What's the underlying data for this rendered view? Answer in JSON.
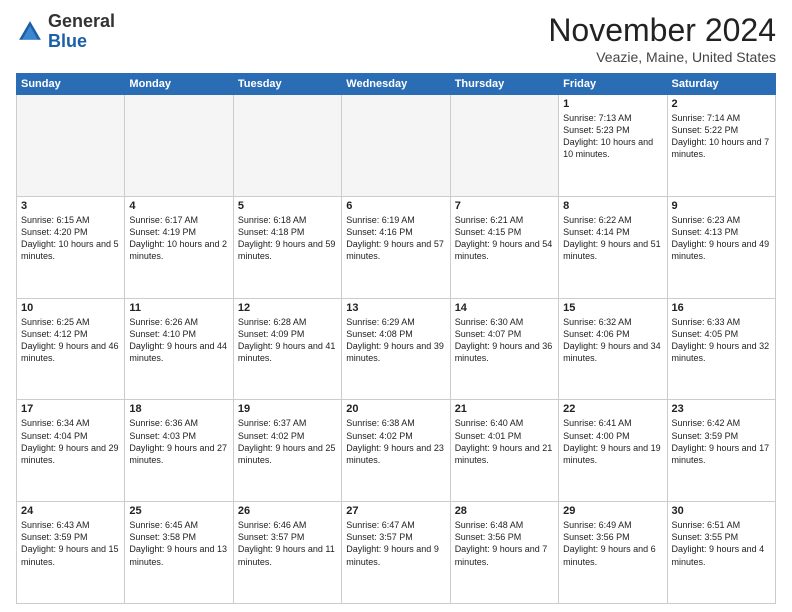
{
  "header": {
    "logo_general": "General",
    "logo_blue": "Blue",
    "month_title": "November 2024",
    "location": "Veazie, Maine, United States"
  },
  "days_of_week": [
    "Sunday",
    "Monday",
    "Tuesday",
    "Wednesday",
    "Thursday",
    "Friday",
    "Saturday"
  ],
  "weeks": [
    [
      {
        "day": "",
        "info": ""
      },
      {
        "day": "",
        "info": ""
      },
      {
        "day": "",
        "info": ""
      },
      {
        "day": "",
        "info": ""
      },
      {
        "day": "",
        "info": ""
      },
      {
        "day": "1",
        "info": "Sunrise: 7:13 AM\nSunset: 5:23 PM\nDaylight: 10 hours and 10 minutes."
      },
      {
        "day": "2",
        "info": "Sunrise: 7:14 AM\nSunset: 5:22 PM\nDaylight: 10 hours and 7 minutes."
      }
    ],
    [
      {
        "day": "3",
        "info": "Sunrise: 6:15 AM\nSunset: 4:20 PM\nDaylight: 10 hours and 5 minutes."
      },
      {
        "day": "4",
        "info": "Sunrise: 6:17 AM\nSunset: 4:19 PM\nDaylight: 10 hours and 2 minutes."
      },
      {
        "day": "5",
        "info": "Sunrise: 6:18 AM\nSunset: 4:18 PM\nDaylight: 9 hours and 59 minutes."
      },
      {
        "day": "6",
        "info": "Sunrise: 6:19 AM\nSunset: 4:16 PM\nDaylight: 9 hours and 57 minutes."
      },
      {
        "day": "7",
        "info": "Sunrise: 6:21 AM\nSunset: 4:15 PM\nDaylight: 9 hours and 54 minutes."
      },
      {
        "day": "8",
        "info": "Sunrise: 6:22 AM\nSunset: 4:14 PM\nDaylight: 9 hours and 51 minutes."
      },
      {
        "day": "9",
        "info": "Sunrise: 6:23 AM\nSunset: 4:13 PM\nDaylight: 9 hours and 49 minutes."
      }
    ],
    [
      {
        "day": "10",
        "info": "Sunrise: 6:25 AM\nSunset: 4:12 PM\nDaylight: 9 hours and 46 minutes."
      },
      {
        "day": "11",
        "info": "Sunrise: 6:26 AM\nSunset: 4:10 PM\nDaylight: 9 hours and 44 minutes."
      },
      {
        "day": "12",
        "info": "Sunrise: 6:28 AM\nSunset: 4:09 PM\nDaylight: 9 hours and 41 minutes."
      },
      {
        "day": "13",
        "info": "Sunrise: 6:29 AM\nSunset: 4:08 PM\nDaylight: 9 hours and 39 minutes."
      },
      {
        "day": "14",
        "info": "Sunrise: 6:30 AM\nSunset: 4:07 PM\nDaylight: 9 hours and 36 minutes."
      },
      {
        "day": "15",
        "info": "Sunrise: 6:32 AM\nSunset: 4:06 PM\nDaylight: 9 hours and 34 minutes."
      },
      {
        "day": "16",
        "info": "Sunrise: 6:33 AM\nSunset: 4:05 PM\nDaylight: 9 hours and 32 minutes."
      }
    ],
    [
      {
        "day": "17",
        "info": "Sunrise: 6:34 AM\nSunset: 4:04 PM\nDaylight: 9 hours and 29 minutes."
      },
      {
        "day": "18",
        "info": "Sunrise: 6:36 AM\nSunset: 4:03 PM\nDaylight: 9 hours and 27 minutes."
      },
      {
        "day": "19",
        "info": "Sunrise: 6:37 AM\nSunset: 4:02 PM\nDaylight: 9 hours and 25 minutes."
      },
      {
        "day": "20",
        "info": "Sunrise: 6:38 AM\nSunset: 4:02 PM\nDaylight: 9 hours and 23 minutes."
      },
      {
        "day": "21",
        "info": "Sunrise: 6:40 AM\nSunset: 4:01 PM\nDaylight: 9 hours and 21 minutes."
      },
      {
        "day": "22",
        "info": "Sunrise: 6:41 AM\nSunset: 4:00 PM\nDaylight: 9 hours and 19 minutes."
      },
      {
        "day": "23",
        "info": "Sunrise: 6:42 AM\nSunset: 3:59 PM\nDaylight: 9 hours and 17 minutes."
      }
    ],
    [
      {
        "day": "24",
        "info": "Sunrise: 6:43 AM\nSunset: 3:59 PM\nDaylight: 9 hours and 15 minutes."
      },
      {
        "day": "25",
        "info": "Sunrise: 6:45 AM\nSunset: 3:58 PM\nDaylight: 9 hours and 13 minutes."
      },
      {
        "day": "26",
        "info": "Sunrise: 6:46 AM\nSunset: 3:57 PM\nDaylight: 9 hours and 11 minutes."
      },
      {
        "day": "27",
        "info": "Sunrise: 6:47 AM\nSunset: 3:57 PM\nDaylight: 9 hours and 9 minutes."
      },
      {
        "day": "28",
        "info": "Sunrise: 6:48 AM\nSunset: 3:56 PM\nDaylight: 9 hours and 7 minutes."
      },
      {
        "day": "29",
        "info": "Sunrise: 6:49 AM\nSunset: 3:56 PM\nDaylight: 9 hours and 6 minutes."
      },
      {
        "day": "30",
        "info": "Sunrise: 6:51 AM\nSunset: 3:55 PM\nDaylight: 9 hours and 4 minutes."
      }
    ]
  ]
}
